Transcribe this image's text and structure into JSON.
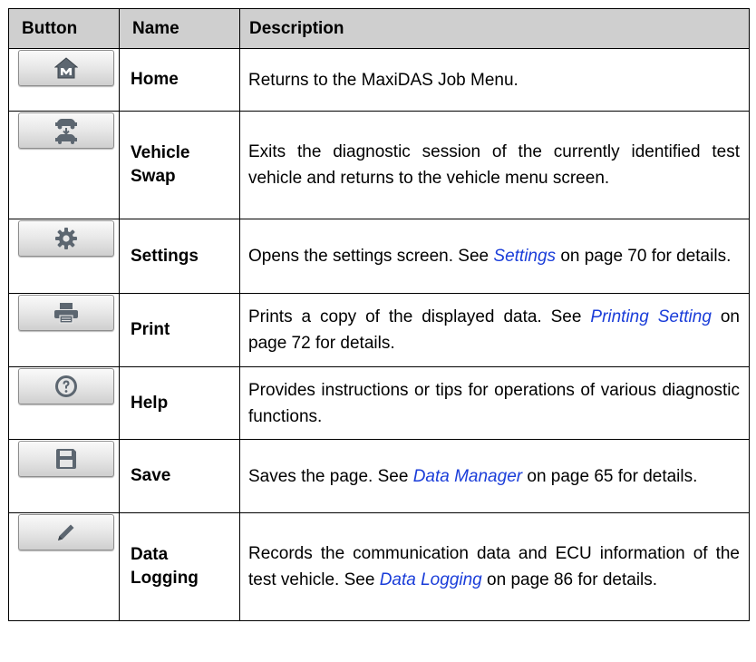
{
  "headers": {
    "button": "Button",
    "name": "Name",
    "description": "Description"
  },
  "rows": [
    {
      "icon": "home-m-icon",
      "name": "Home",
      "desc_pre": "Returns to the MaxiDAS Job Menu.",
      "link": "",
      "desc_post": ""
    },
    {
      "icon": "vehicle-swap-icon",
      "name": "Vehicle Swap",
      "desc_pre": "Exits the diagnostic session of the currently identified test vehicle and returns to the vehicle menu screen.",
      "link": "",
      "desc_post": ""
    },
    {
      "icon": "gear-icon",
      "name": "Settings",
      "desc_pre": "Opens the settings screen. See ",
      "link": "Settings",
      "desc_post": " on page 70 for details."
    },
    {
      "icon": "printer-icon",
      "name": "Print",
      "desc_pre": "Prints a copy of the displayed data. See ",
      "link": "Printing Setting",
      "desc_post": " on page 72 for details."
    },
    {
      "icon": "help-icon",
      "name": "Help",
      "desc_pre": "Provides instructions or tips for operations of various diagnostic functions.",
      "link": "",
      "desc_post": ""
    },
    {
      "icon": "save-icon",
      "name": "Save",
      "desc_pre": "Saves the page. See ",
      "link": "Data Manager",
      "desc_post": " on page 65 for details."
    },
    {
      "icon": "pencil-icon",
      "name": "Data Logging",
      "desc_pre": "Records the communication data and ECU information of the test vehicle. See ",
      "link": "Data Logging",
      "desc_post": " on page 86 for details."
    }
  ]
}
